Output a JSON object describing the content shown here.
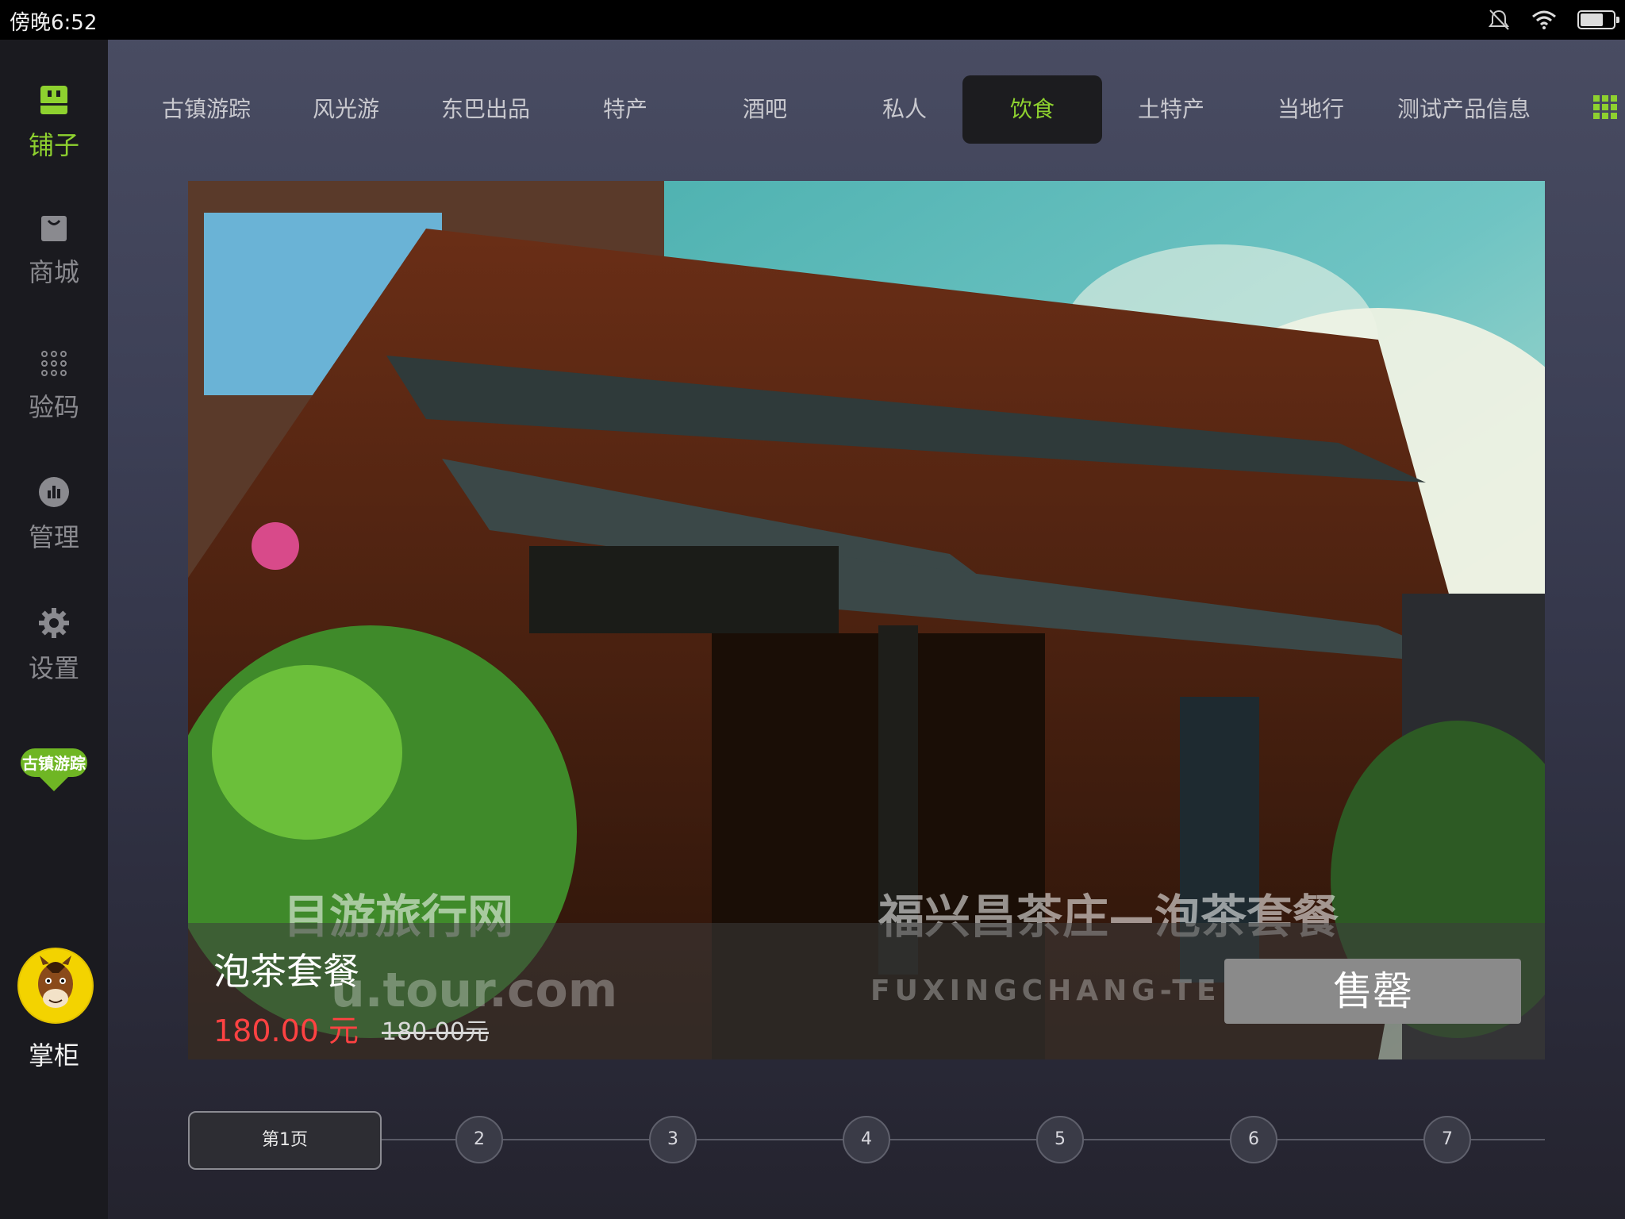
{
  "status_bar": {
    "time": "傍晚6:52",
    "icons": [
      "mute-icon",
      "wifi-icon",
      "battery-icon"
    ],
    "battery_level_percent": 70
  },
  "sidebar": {
    "items": [
      {
        "label": "铺子",
        "icon": "shop-icon",
        "active": true
      },
      {
        "label": "商城",
        "icon": "bag-icon",
        "active": false
      },
      {
        "label": "验码",
        "icon": "keypad-icon",
        "active": false
      },
      {
        "label": "管理",
        "icon": "chart-icon",
        "active": false
      },
      {
        "label": "设置",
        "icon": "gear-icon",
        "active": false
      }
    ],
    "brand_logo_text": "古镇游踪",
    "profile_label": "掌柜"
  },
  "tabs": [
    {
      "label": "古镇游踪"
    },
    {
      "label": "风光游"
    },
    {
      "label": "东巴出品"
    },
    {
      "label": "特产"
    },
    {
      "label": "酒吧"
    },
    {
      "label": "私人"
    },
    {
      "label": "饮食",
      "active": true
    },
    {
      "label": "土特产"
    },
    {
      "label": "当地行"
    },
    {
      "label": "测试产品信息"
    }
  ],
  "banner": {
    "title": "泡茶套餐",
    "price": "180.00 元",
    "original_price": "180.00元",
    "status_button": "售罄",
    "watermark_site": "目游旅行网",
    "watermark_caption": "福兴昌茶庄—泡茶套餐",
    "watermark_url": "u.tour.com",
    "watermark_en": "FUXINGCHANG-TE"
  },
  "pagination": {
    "first_label": "第1页",
    "pages": [
      "2",
      "3",
      "4",
      "5",
      "6",
      "7"
    ]
  },
  "colors": {
    "accent": "#8ed12f",
    "price": "#ff4242",
    "sidebar_bg": "#1a1a1f"
  }
}
